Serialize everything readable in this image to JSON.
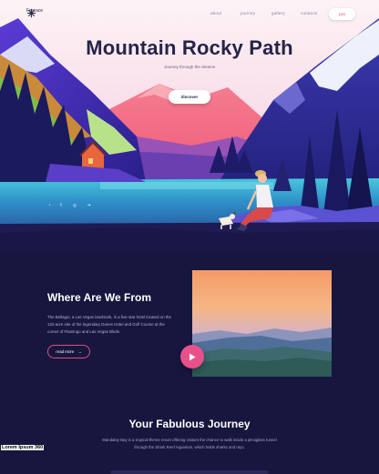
{
  "nav": {
    "logo_text": "Fevrace",
    "links": [
      "about",
      "journey",
      "gallery",
      "contacts"
    ],
    "join_label": "join"
  },
  "hero": {
    "title": "Mountain Rocky Path",
    "subtitle": "Journey through the dreams",
    "discover_label": "discover"
  },
  "social": {
    "icons": [
      "rss-icon",
      "facebook-icon",
      "instagram-icon",
      "twitter-icon"
    ],
    "glyphs": [
      "◔",
      "f",
      "◎",
      "❧"
    ]
  },
  "where": {
    "title": "Where Are We From",
    "body": "The Bellagio, a Las Vegas landmark, is a five-star hotel located on the 122-acre site of the legendary Dunes Hotel and Golf Course at the corner of Flamingo and Las Vegas Blvds.",
    "read_more_label": "read more",
    "arrow": "→"
  },
  "journey": {
    "title": "Your Fabulous Journey",
    "body": "Mandalay Bay is a tropical-theme resort offering visitors the chance to walk inside a plexiglass tunnel through the Shark Reef Aquarium, which holds sharks and rays."
  },
  "watermark": "Lorem Ipsum 360",
  "colors": {
    "accent": "#e2507a",
    "dark_bg": "#17163f",
    "title": "#262448"
  }
}
